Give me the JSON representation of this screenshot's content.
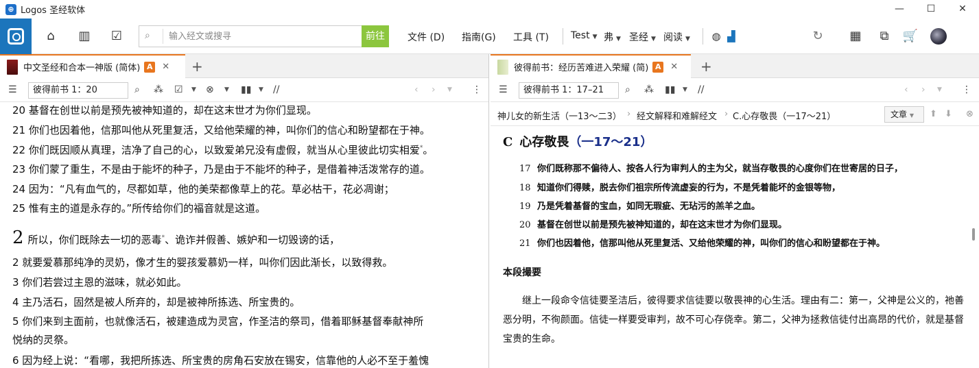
{
  "window": {
    "title": "Logos 圣经软体",
    "minimize": "—",
    "maximize": "☐",
    "close": "✕"
  },
  "toolbar": {
    "search_placeholder": "输入经文或搜寻",
    "go_label": "前往",
    "menus": {
      "file": "文件 (D)",
      "guide": "指南(G)",
      "tools": "工具 (T)",
      "test": "Test",
      "fu": "弗",
      "bible": "圣经",
      "read": "阅读"
    },
    "accent": "#1c75bc",
    "go_color": "#8cc63e"
  },
  "left_pane": {
    "tab_title": "中文圣经和合本一神版 (简体)",
    "tab_badge": "A",
    "reference": "彼得前书 1：20",
    "verses": [
      {
        "text": "20 基督在创世以前是预先被神知道的，却在这末世才为你们显现。"
      },
      {
        "text": "21 你们也因着他，信那叫他从死里复活，又给他荣耀的神，叫你们的信心和盼望都在于神。"
      },
      {
        "text": "22 你们既因顺从真理，洁净了自己的心，以致爱弟兄没有虚假，就当从心里彼此切实相爱",
        "sup": "*",
        "tail": "。"
      },
      {
        "text": "23 你们蒙了重生，不是由于能坏的种子，乃是由于不能坏的种子，是借着神活泼常存的道。"
      },
      {
        "text": "24 因为：“凡有血气的，尽都如草，他的美荣都像草上的花。草必枯干，花必凋谢；"
      },
      {
        "text": "25 惟有主的道是永存的。”所传给你们的福音就是这道。"
      }
    ],
    "chapter2": {
      "number": "2",
      "first": "所以，你们既除去一切的恶毒",
      "sup": "*",
      "first_tail": "、诡诈并假善、嫉妒和一切毁谤的话，"
    },
    "verses2": [
      "2 就要爱慕那纯净的灵奶，像才生的婴孩爱慕奶一样，叫你们因此渐长，以致得救。",
      "3 你们若尝过主恩的滋味，就必如此。",
      "4 主乃活石，固然是被人所弃的，却是被神所拣选、所宝贵的。",
      "5 你们来到主面前，也就像活石，被建造成为灵宫，作圣洁的祭司，借着耶稣基督奉献神所",
      "悦纳的灵祭。",
      "6 因为经上说：“看哪，我把所拣选、所宝贵的房角石安放在锡安，信靠他的人必不至于羞愧"
    ]
  },
  "right_pane": {
    "tab_title": "彼得前书：经历苦难进入荣耀 (简)",
    "tab_badge": "A",
    "reference": "彼得前书 1：17–21",
    "breadcrumb": [
      "神儿女的新生活（一13～二3）",
      "经文解释和难解经文",
      "C.心存敬畏（一17～21）"
    ],
    "article_label": "文章",
    "section": {
      "letter": "C",
      "title": "心存敬畏",
      "range": "（一17～21）"
    },
    "verses": [
      {
        "num": "17",
        "text": "你们既称那不偏待人、按各人行为审判人的主为父，就当存敬畏的心度你们在世寄居的日子，"
      },
      {
        "num": "18",
        "text": "知道你们得赎，脱去你们祖宗所传流虚妄的行为，不是凭着能坏的金银等物，"
      },
      {
        "num": "19",
        "text": "乃是凭着基督的宝血，如同无瑕疵、无玷污的羔羊之血。"
      },
      {
        "num": "20",
        "text": "基督在创世以前是预先被神知道的，却在这末世才为你们显现。"
      },
      {
        "num": "21",
        "text": "你们也因着他，信那叫他从死里复活、又给他荣耀的神，叫你们的信心和盼望都在于神。"
      }
    ],
    "summary_heading": "本段撮要",
    "summary_text": "继上一段命令信徒要圣洁后，彼得要求信徒要以敬畏神的心生活。理由有二：第一，父神是公义的，祂善恶分明，不徇颜面。信徒一样要受审判，故不可心存侥幸。第二，父神为拯救信徒付出高昂的代价，就是基督宝贵的生命。"
  }
}
